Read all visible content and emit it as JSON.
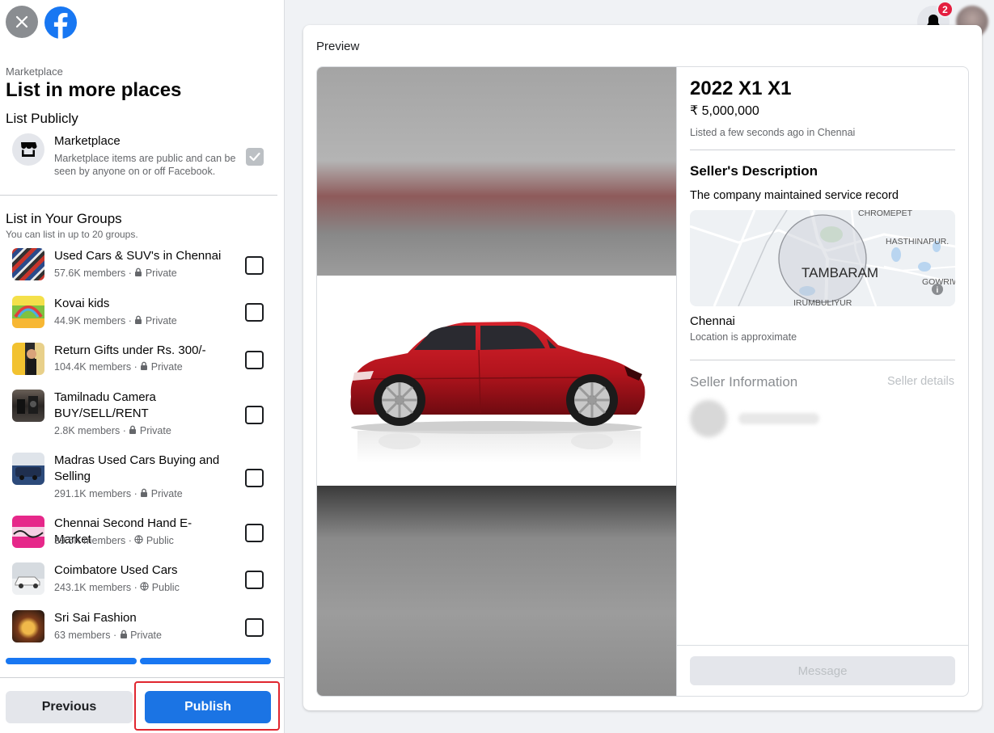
{
  "sidebar": {
    "breadcrumb": "Marketplace",
    "title": "List in more places",
    "list_publicly": "List Publicly",
    "marketplace": {
      "name": "Marketplace",
      "desc": "Marketplace items are public and can be seen by anyone on or off Facebook.",
      "checked": true
    },
    "groups_heading": "List in Your Groups",
    "groups_sub": "You can list in up to 20 groups.",
    "groups": [
      {
        "name": "Used Cars & SUV's in Chennai",
        "members": "57.6K members",
        "privacy": "Private"
      },
      {
        "name": "Kovai kids",
        "members": "44.9K members",
        "privacy": "Private"
      },
      {
        "name": "Return Gifts under Rs. 300/-",
        "members": "104.4K members",
        "privacy": "Private"
      },
      {
        "name": "Tamilnadu Camera BUY/SELL/RENT",
        "members": "2.8K members",
        "privacy": "Private"
      },
      {
        "name": "Madras Used Cars Buying and Selling",
        "members": "291.1K members",
        "privacy": "Private"
      },
      {
        "name": "Chennai Second Hand E-Market",
        "members": "39.5K members",
        "privacy": "Public"
      },
      {
        "name": "Coimbatore Used Cars",
        "members": "243.1K members",
        "privacy": "Public"
      },
      {
        "name": "Sri Sai Fashion",
        "members": "63 members",
        "privacy": "Private"
      }
    ],
    "previous_label": "Previous",
    "publish_label": "Publish"
  },
  "header": {
    "notification_count": "2"
  },
  "preview": {
    "label": "Preview",
    "title": "2022 X1 X1",
    "price": "₹ 5,000,000",
    "listed": "Listed a few seconds ago in Chennai",
    "seller_desc_heading": "Seller's Description",
    "seller_desc": "The company maintained service record",
    "map_labels": {
      "main": "TAMBARAM",
      "north": "CHROMEPET",
      "east": "HASTHINAPUR.",
      "southeast": "GOWRIW",
      "south": "IRUMBULIYUR"
    },
    "city": "Chennai",
    "approx": "Location is approximate",
    "seller_info": "Seller Information",
    "seller_details": "Seller details",
    "message_label": "Message"
  },
  "colors": {
    "brand": "#1877f2",
    "publish": "#1b74e4",
    "highlight": "#e0262f",
    "car": "#b3141d"
  }
}
